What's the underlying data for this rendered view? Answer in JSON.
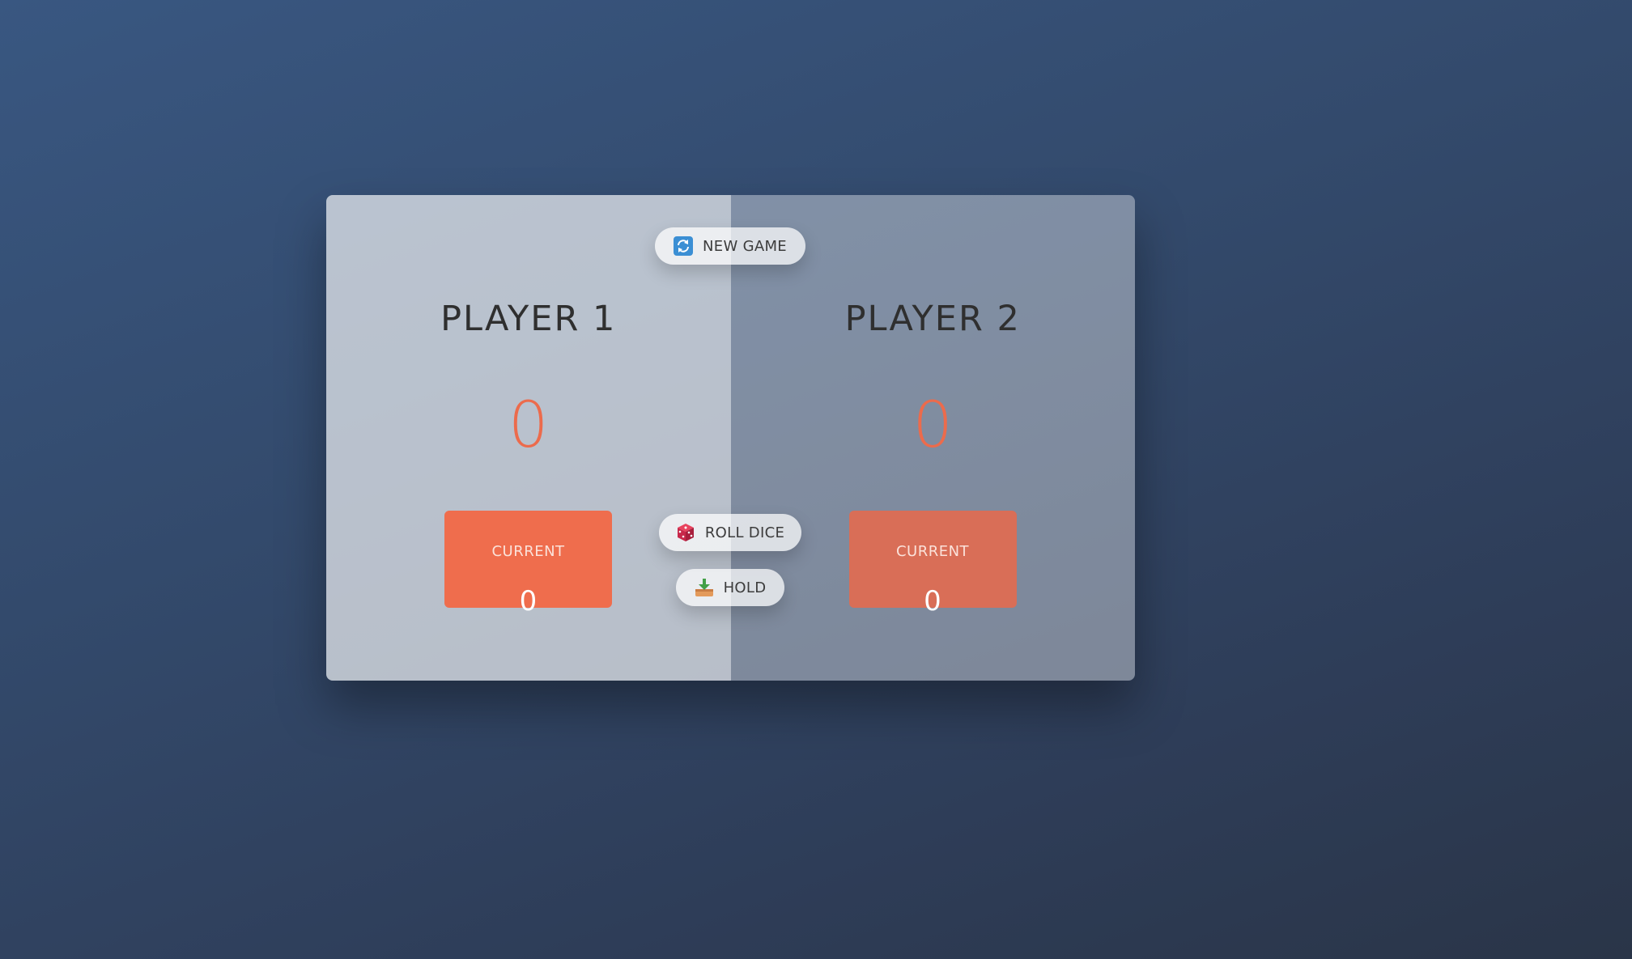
{
  "players": [
    {
      "name": "PLAYER 1",
      "score": "0",
      "current_label": "CURRENT",
      "current_score": "0",
      "active": true
    },
    {
      "name": "PLAYER 2",
      "score": "0",
      "current_label": "CURRENT",
      "current_score": "0",
      "active": false
    }
  ],
  "buttons": {
    "new_game": {
      "label": "NEW GAME",
      "icon": "refresh-icon"
    },
    "roll_dice": {
      "label": "ROLL DICE",
      "icon": "dice-icon"
    },
    "hold": {
      "label": "HOLD",
      "icon": "download-tray-icon"
    }
  },
  "colors": {
    "accent": "#ec6b4c",
    "current_box": "#ef6d4d",
    "background_top": "#395781",
    "background_bottom": "#2a3548"
  }
}
